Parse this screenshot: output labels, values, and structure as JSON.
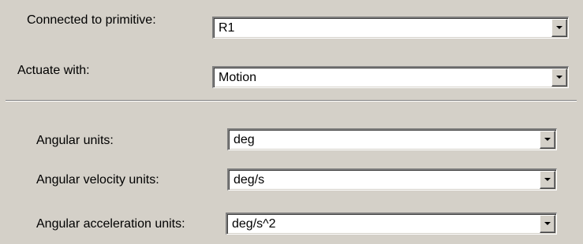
{
  "primitive": {
    "label": "Connected to primitive:",
    "value": "R1"
  },
  "actuate": {
    "label": "Actuate with:",
    "value": "Motion"
  },
  "angular_units": {
    "label": "Angular units:",
    "value": "deg"
  },
  "angular_velocity_units": {
    "label": "Angular velocity units:",
    "value": "deg/s"
  },
  "angular_acceleration_units": {
    "label": "Angular acceleration units:",
    "value": "deg/s^2"
  },
  "icons": {
    "dropdown": "chevron-down-icon"
  }
}
